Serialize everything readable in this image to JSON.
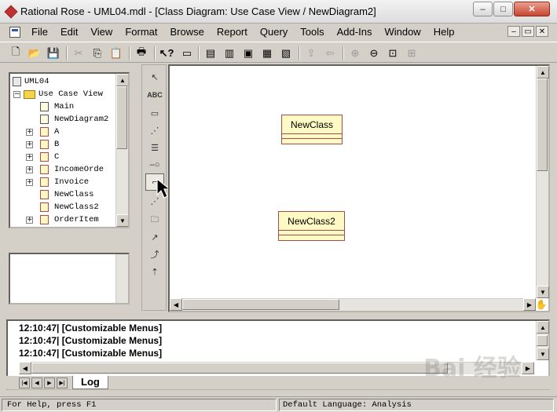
{
  "window": {
    "title": "Rational Rose - UML04.mdl - [Class Diagram: Use Case View / NewDiagram2]",
    "controls": [
      "–",
      "□",
      "✕"
    ]
  },
  "menu": [
    "File",
    "Edit",
    "View",
    "Format",
    "Browse",
    "Report",
    "Query",
    "Tools",
    "Add-Ins",
    "Window",
    "Help"
  ],
  "mdi_controls": [
    "–",
    "▭",
    "✕"
  ],
  "toolbar_icons": [
    "new-icon",
    "open-icon",
    "save-icon",
    "cut-icon",
    "copy-icon",
    "paste-icon",
    "print-icon",
    "context-help-icon",
    "view-doc-icon",
    "browse-class-diagram-icon",
    "browse-interaction-diagram-icon",
    "browse-component-diagram-icon",
    "browse-deployment-diagram-icon",
    "browse-state-diagram-icon",
    "browse-parent-icon",
    "browse-previous-icon",
    "zoom-in-icon",
    "zoom-out-icon",
    "fit-window-icon",
    "undo-fit-icon"
  ],
  "browser": {
    "items": [
      {
        "label": "UML04",
        "icon": "model-icon",
        "expander": ""
      },
      {
        "label": "Use Case View",
        "icon": "folder-icon",
        "expander": "−"
      },
      {
        "label": "Main",
        "icon": "use-case-diagram-icon",
        "expander": ""
      },
      {
        "label": "NewDiagram2",
        "icon": "class-diagram-icon",
        "expander": ""
      },
      {
        "label": "A",
        "icon": "class-icon",
        "expander": "+"
      },
      {
        "label": "B",
        "icon": "class-icon",
        "expander": "+"
      },
      {
        "label": "C",
        "icon": "class-icon",
        "expander": "+"
      },
      {
        "label": "IncomeOrde",
        "icon": "class-icon",
        "expander": "+"
      },
      {
        "label": "Invoice",
        "icon": "class-icon",
        "expander": "+"
      },
      {
        "label": "NewClass",
        "icon": "class-icon",
        "expander": ""
      },
      {
        "label": "NewClass2",
        "icon": "class-icon",
        "expander": ""
      },
      {
        "label": "OrderItem",
        "icon": "class-icon",
        "expander": "+"
      }
    ]
  },
  "toolbox": [
    "selection-arrow-icon",
    "text-box-icon",
    "note-icon",
    "anchor-note-icon",
    "class-icon",
    "interface-icon",
    "unidirectional-association-icon",
    "association-class-icon",
    "package-icon",
    "dependency-icon",
    "generalization-icon",
    "realization-icon"
  ],
  "toolbox_text": "ABC",
  "diagram": {
    "classes": [
      {
        "name": "NewClass"
      },
      {
        "name": "NewClass2"
      }
    ]
  },
  "log": {
    "lines": [
      "12:10:47|  [Customizable Menus]",
      "12:10:47|  [Customizable Menus]",
      "12:10:47|  [Customizable Menus]"
    ],
    "tab": "Log"
  },
  "status": {
    "left": "For Help, press F1",
    "right": "Default Language: Analysis"
  },
  "watermark": "Bai 经验"
}
